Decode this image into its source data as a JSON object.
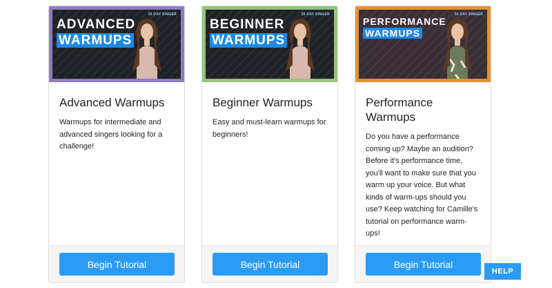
{
  "cards": [
    {
      "thumb_line1": "ADVANCED",
      "thumb_line2": "WARMUPS",
      "logo": "30 DAY SINGER",
      "border_color": "#8e7cc3",
      "title": "Advanced Warmups",
      "description": "Warmups for intermediate and advanced singers looking for a challenge!",
      "button_label": "Begin Tutorial"
    },
    {
      "thumb_line1": "BEGINNER",
      "thumb_line2": "WARMUPS",
      "logo": "30 DAY SINGER",
      "border_color": "#93c47d",
      "title": "Beginner Warmups",
      "description": "Easy and must-learn warmups for beginners!",
      "button_label": "Begin Tutorial"
    },
    {
      "thumb_line1": "PERFORMANCE",
      "thumb_line2": "WARMUPS",
      "logo": "30 DAY SINGER",
      "border_color": "#e69138",
      "title": "Performance Warmups",
      "description": "Do you have a performance coming up? Maybe an audition? Before it's performance time, you'll want to make sure that you warm up your voice. But what kinds of warm-ups should you use? Keep watching for Camille's tutorial on performance warm-ups!",
      "button_label": "Begin Tutorial"
    }
  ],
  "help_label": "HELP",
  "colors": {
    "button": "#2b9af3",
    "title_band": "#1e88e5"
  }
}
